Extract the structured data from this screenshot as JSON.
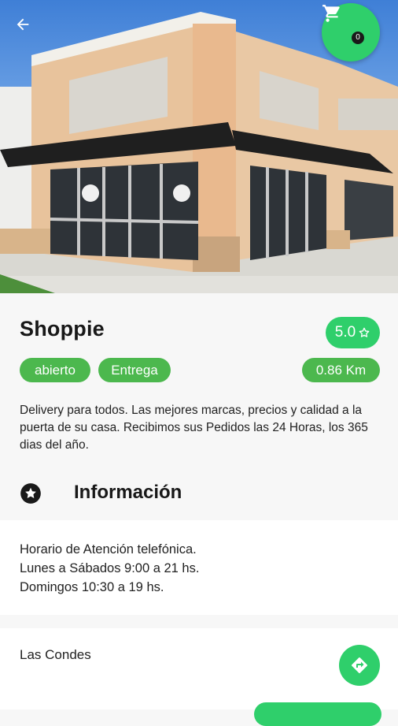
{
  "header": {
    "back_icon": "arrow-left-icon",
    "cart_icon": "shopping-cart-icon",
    "cart_count": "0"
  },
  "store": {
    "name": "Shoppie",
    "rating": "5.0",
    "rating_icon": "star-outline-icon",
    "tags": [
      "abierto",
      "Entrega"
    ],
    "distance": "0.86 Km",
    "description": "Delivery para todos. Las mejores marcas, precios y calidad a la puerta de su casa. Recibimos sus Pedidos las 24 Horas, los 365 dias del año."
  },
  "info": {
    "title": "Información",
    "icon": "star-circle-icon"
  },
  "hours": {
    "line1": "Horario de Atención telefónica.",
    "line2": "Lunes a Sábados 9:00 a 21 hs.",
    "line3": "Domingos 10:30 a 19 hs."
  },
  "address": {
    "text": "Las Condes",
    "directions_icon": "directions-icon"
  },
  "colors": {
    "accent": "#2fcf6b",
    "chip": "#4cb84e",
    "text": "#1b1b1b",
    "background": "#f7f7f7"
  }
}
